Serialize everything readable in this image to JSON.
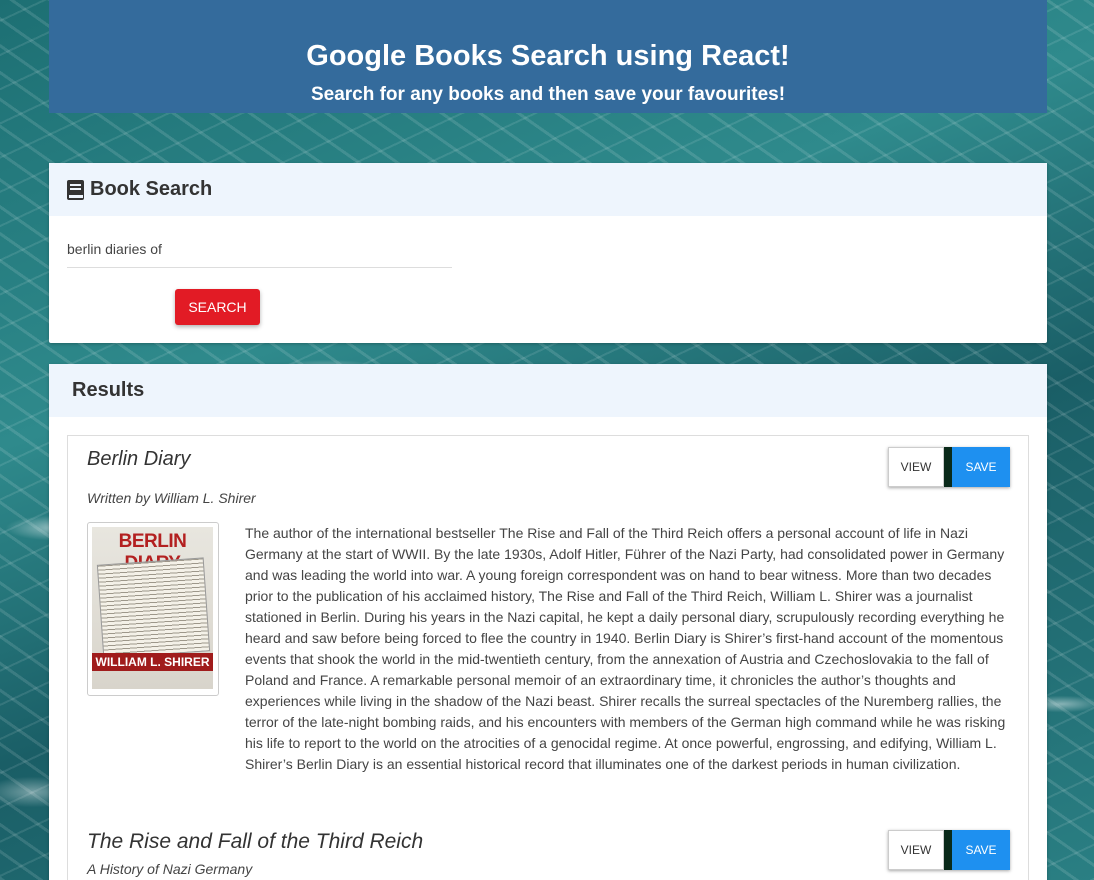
{
  "header": {
    "title": "Google Books Search using React!",
    "subtitle": "Search for any books and then save your favourites!"
  },
  "search": {
    "heading": "Book Search",
    "input_value": "berlin diaries of",
    "button_label": "SEARCH"
  },
  "results": {
    "heading": "Results",
    "view_label": "VIEW",
    "save_label": "SAVE",
    "books": [
      {
        "title": "Berlin Diary",
        "author": "Written by William L. Shirer",
        "cover_title": "BERLIN DIARY",
        "cover_author": "WILLIAM L. SHIRER",
        "description": "The author of the international bestseller The Rise and Fall of the Third Reich offers a personal account of life in Nazi Germany at the start of WWII. By the late 1930s, Adolf Hitler, Führer of the Nazi Party, had consolidated power in Germany and was leading the world into war. A young foreign correspondent was on hand to bear witness. More than two decades prior to the publication of his acclaimed history, The Rise and Fall of the Third Reich, William L. Shirer was a journalist stationed in Berlin. During his years in the Nazi capital, he kept a daily personal diary, scrupulously recording everything he heard and saw before being forced to flee the country in 1940. Berlin Diary is Shirer’s first-hand account of the momentous events that shook the world in the mid-twentieth century, from the annexation of Austria and Czechoslovakia to the fall of Poland and France. A remarkable personal memoir of an extraordinary time, it chronicles the author’s thoughts and experiences while living in the shadow of the Nazi beast. Shirer recalls the surreal spectacles of the Nuremberg rallies, the terror of the late-night bombing raids, and his encounters with members of the German high command while he was risking his life to report to the world on the atrocities of a genocidal regime. At once powerful, engrossing, and edifying, William L. Shirer’s Berlin Diary is an essential historical record that illuminates one of the darkest periods in human civilization."
      },
      {
        "title": "The Rise and Fall of the Third Reich",
        "author": "A History of Nazi Germany"
      }
    ]
  },
  "colors": {
    "header_bg": "#346b9c",
    "search_button": "#e21b25",
    "save_button": "#1e90f0",
    "card_head_bg": "#eef5fd"
  }
}
